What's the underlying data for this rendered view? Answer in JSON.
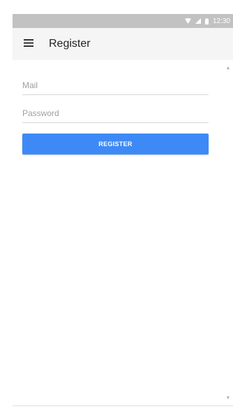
{
  "status_bar": {
    "time": "12:30",
    "icons": [
      "wifi-icon",
      "cellular-signal-icon",
      "battery-icon"
    ],
    "background_color": "#c2c2c2"
  },
  "toolbar": {
    "menu_icon": "hamburger-menu-icon",
    "title": "Register"
  },
  "form": {
    "mail": {
      "placeholder": "Mail",
      "value": ""
    },
    "password": {
      "placeholder": "Password",
      "value": ""
    },
    "register_label": "REGISTER",
    "button_color": "#3d8af7"
  },
  "scrollbar": {
    "up_icon": "scroll-up-arrow-icon",
    "down_icon": "scroll-down-arrow-icon"
  }
}
